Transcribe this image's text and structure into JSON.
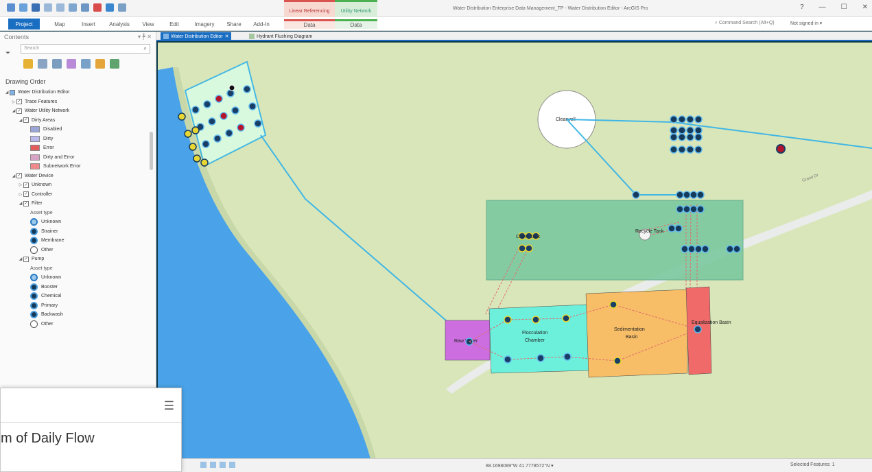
{
  "window": {
    "title": "Water Distribution Enterprise Data Management_TP - Water Distribution Editor - ArcGIS Pro",
    "controls": [
      "?",
      "—",
      "☐",
      "✕"
    ]
  },
  "context_groups": {
    "linear_referencing": "Linear Referencing",
    "utility_network": "Utility Network"
  },
  "ribbon": {
    "tabs": [
      "Project",
      "Map",
      "Insert",
      "Analysis",
      "View",
      "Edit",
      "Imagery",
      "Share",
      "Add-In",
      "Data",
      "Data"
    ],
    "search_placeholder": "Command Search (Alt+Q)",
    "signin": "Not signed in ▾"
  },
  "contents": {
    "title": "Contents",
    "pane_controls": "▾ ╄ ✕",
    "search_placeholder": "Search",
    "drawing_order_label": "Drawing Order",
    "tree": [
      {
        "text": "Water Distribution Editor",
        "indent": 0,
        "exp": "◢",
        "kind": "map"
      },
      {
        "text": "Trace Features",
        "indent": 1,
        "exp": "▷",
        "kind": "check"
      },
      {
        "text": "Water Utility Network",
        "indent": 1,
        "exp": "◢",
        "kind": "check"
      },
      {
        "text": "Dirty Areas",
        "indent": 2,
        "exp": "◢",
        "kind": "check"
      },
      {
        "text": "Disabled",
        "indent": 3,
        "kind": "swatch",
        "color": "#9aa6d8"
      },
      {
        "text": "Dirty",
        "indent": 3,
        "kind": "swatch",
        "color": "#b9b9ec"
      },
      {
        "text": "Error",
        "indent": 3,
        "kind": "swatch",
        "color": "#e35c5c"
      },
      {
        "text": "Dirty and Error",
        "indent": 3,
        "kind": "swatch",
        "color": "#d6a3c4"
      },
      {
        "text": "Subnetwork Error",
        "indent": 3,
        "kind": "swatch",
        "color": "#f08a8a"
      },
      {
        "text": "Water Device",
        "indent": 1,
        "exp": "◢",
        "kind": "check"
      },
      {
        "text": "Unknown",
        "indent": 2,
        "exp": "▷",
        "kind": "check"
      },
      {
        "text": "Controller",
        "indent": 2,
        "exp": "▷",
        "kind": "check"
      },
      {
        "text": "Filter",
        "indent": 2,
        "exp": "◢",
        "kind": "check"
      },
      {
        "text": "Asset type",
        "indent": 3,
        "kind": "label"
      },
      {
        "text": "Unknown",
        "indent": 3,
        "kind": "sym",
        "style": "light"
      },
      {
        "text": "Strainer",
        "indent": 3,
        "kind": "sym",
        "style": "dark"
      },
      {
        "text": "Membrane",
        "indent": 3,
        "kind": "sym",
        "style": "dark"
      },
      {
        "text": "Other",
        "indent": 3,
        "kind": "sym",
        "style": "empty"
      },
      {
        "text": "Pump",
        "indent": 2,
        "exp": "◢",
        "kind": "check"
      },
      {
        "text": "Asset type",
        "indent": 3,
        "kind": "label"
      },
      {
        "text": "Unknown",
        "indent": 3,
        "kind": "sym",
        "style": "light"
      },
      {
        "text": "Booster",
        "indent": 3,
        "kind": "sym",
        "style": "dark"
      },
      {
        "text": "Chemical",
        "indent": 3,
        "kind": "sym",
        "style": "dark"
      },
      {
        "text": "Primary",
        "indent": 3,
        "kind": "sym",
        "style": "dark"
      },
      {
        "text": "Backwash",
        "indent": 3,
        "kind": "sym",
        "style": "dark"
      },
      {
        "text": "Other",
        "indent": 3,
        "kind": "sym",
        "style": "empty"
      }
    ]
  },
  "view_tabs": [
    {
      "label": "Water Distribution Editor",
      "close": "✕"
    },
    {
      "label": "Hydrant Flushing Diagram"
    }
  ],
  "map": {
    "labels": {
      "clearwell": "Clearwell",
      "chem_tank": "Chem Tank",
      "recycle_tank": "Recycle Tank",
      "raw_water": "Raw Water",
      "flocculation": "Flocculation Chamber",
      "sedimentation": "Sedimentation Basin",
      "equalization": "Equalization Basin",
      "road": "Grand Dr"
    },
    "colors": {
      "land": "#d9e6b9",
      "water": "#4aa3e8",
      "pipe": "#3fb6e6",
      "raw_water": "#cc6ee0",
      "flocculation": "#6cf0dc",
      "sedimentation": "#f7bd67",
      "equalization": "#f06a6a",
      "treatment_area": "#7cc9a0"
    }
  },
  "statusbar": {
    "coordinates": "88.1698089°W 41.7778572°N ▾",
    "selected": "Selected Features: 1"
  },
  "popup": {
    "text": "m of Daily Flow",
    "menu_icon": "☰"
  }
}
